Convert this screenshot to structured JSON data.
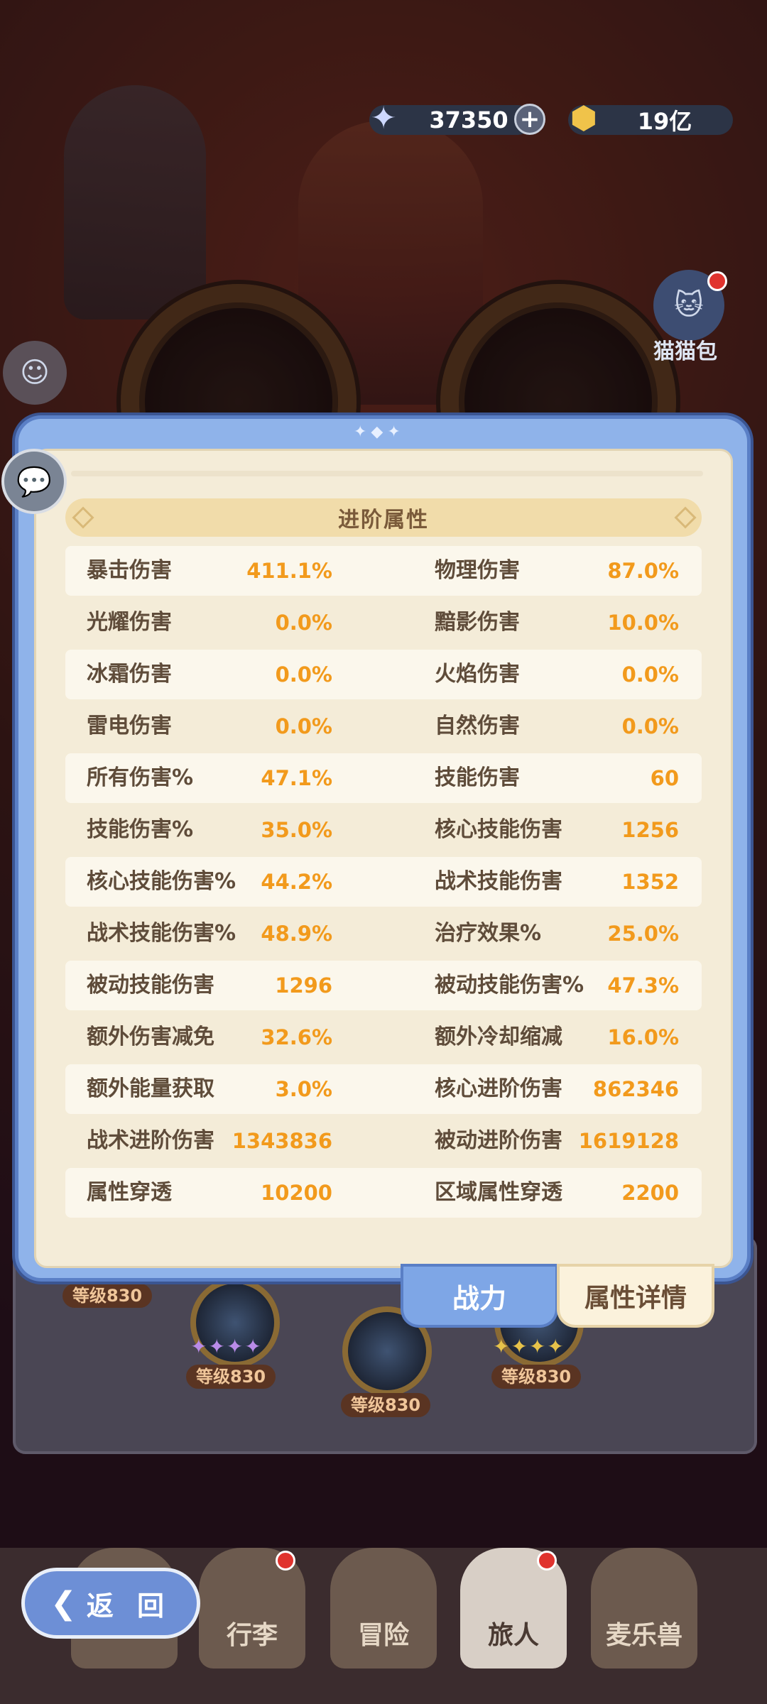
{
  "currency": {
    "gems_icon": "star-crystal-icon",
    "gems": "37350",
    "gold_icon": "gold-coin-icon",
    "gold": "19亿"
  },
  "side": {
    "cat_bag_label": "猫猫包"
  },
  "panel": {
    "section_title": "进阶属性",
    "rows": [
      {
        "n1": "暴击伤害",
        "v1": "411.1%",
        "n2": "物理伤害",
        "v2": "87.0%"
      },
      {
        "n1": "光耀伤害",
        "v1": "0.0%",
        "n2": "黯影伤害",
        "v2": "10.0%"
      },
      {
        "n1": "冰霜伤害",
        "v1": "0.0%",
        "n2": "火焰伤害",
        "v2": "0.0%"
      },
      {
        "n1": "雷电伤害",
        "v1": "0.0%",
        "n2": "自然伤害",
        "v2": "0.0%"
      },
      {
        "n1": "所有伤害%",
        "v1": "47.1%",
        "n2": "技能伤害",
        "v2": "60"
      },
      {
        "n1": "技能伤害%",
        "v1": "35.0%",
        "n2": "核心技能伤害",
        "v2": "1256"
      },
      {
        "n1": "核心技能伤害%",
        "v1": "44.2%",
        "n2": "战术技能伤害",
        "v2": "1352"
      },
      {
        "n1": "战术技能伤害%",
        "v1": "48.9%",
        "n2": "治疗效果%",
        "v2": "25.0%"
      },
      {
        "n1": "被动技能伤害",
        "v1": "1296",
        "n2": "被动技能伤害%",
        "v2": "47.3%"
      },
      {
        "n1": "额外伤害减免",
        "v1": "32.6%",
        "n2": "额外冷却缩减",
        "v2": "16.0%"
      },
      {
        "n1": "额外能量获取",
        "v1": "3.0%",
        "n2": "核心进阶伤害",
        "v2": "862346"
      },
      {
        "n1": "战术进阶伤害",
        "v1": "1343836",
        "n2": "被动进阶伤害",
        "v2": "1619128"
      },
      {
        "n1": "属性穿透",
        "v1": "10200",
        "n2": "区域属性穿透",
        "v2": "2200"
      }
    ]
  },
  "tabs": {
    "power": "战力",
    "details": "属性详情"
  },
  "skills": {
    "level_label": "等级830"
  },
  "nav": {
    "back": "返 回",
    "luggage": "行李",
    "adventure": "冒险",
    "traveler": "旅人",
    "beast": "麦乐兽"
  }
}
